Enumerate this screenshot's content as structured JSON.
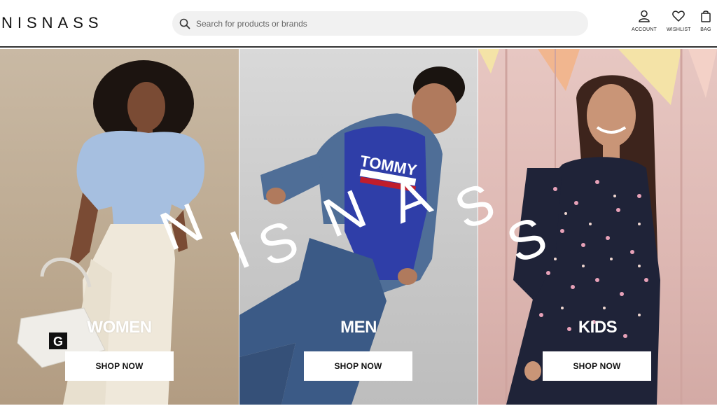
{
  "header": {
    "logo": "NISNASS",
    "search_placeholder": "Search for products or brands",
    "account_label": "ACCOUNT",
    "wishlist_label": "WISHLIST",
    "bag_label": "BAG"
  },
  "hero": {
    "brand_overlay": "NISNASS",
    "panels": [
      {
        "label": "WOMEN",
        "button": "SHOP NOW"
      },
      {
        "label": "MEN",
        "button": "SHOP NOW"
      },
      {
        "label": "KIDS",
        "button": "SHOP NOW"
      }
    ]
  },
  "icons": {
    "search": "search-icon",
    "account": "user-icon",
    "wishlist": "heart-icon",
    "bag": "bag-icon"
  },
  "colors": {
    "header_bg": "#ffffff",
    "search_bg": "#f1f1f1",
    "button_bg": "#ffffff",
    "label_text": "#ffffff"
  }
}
